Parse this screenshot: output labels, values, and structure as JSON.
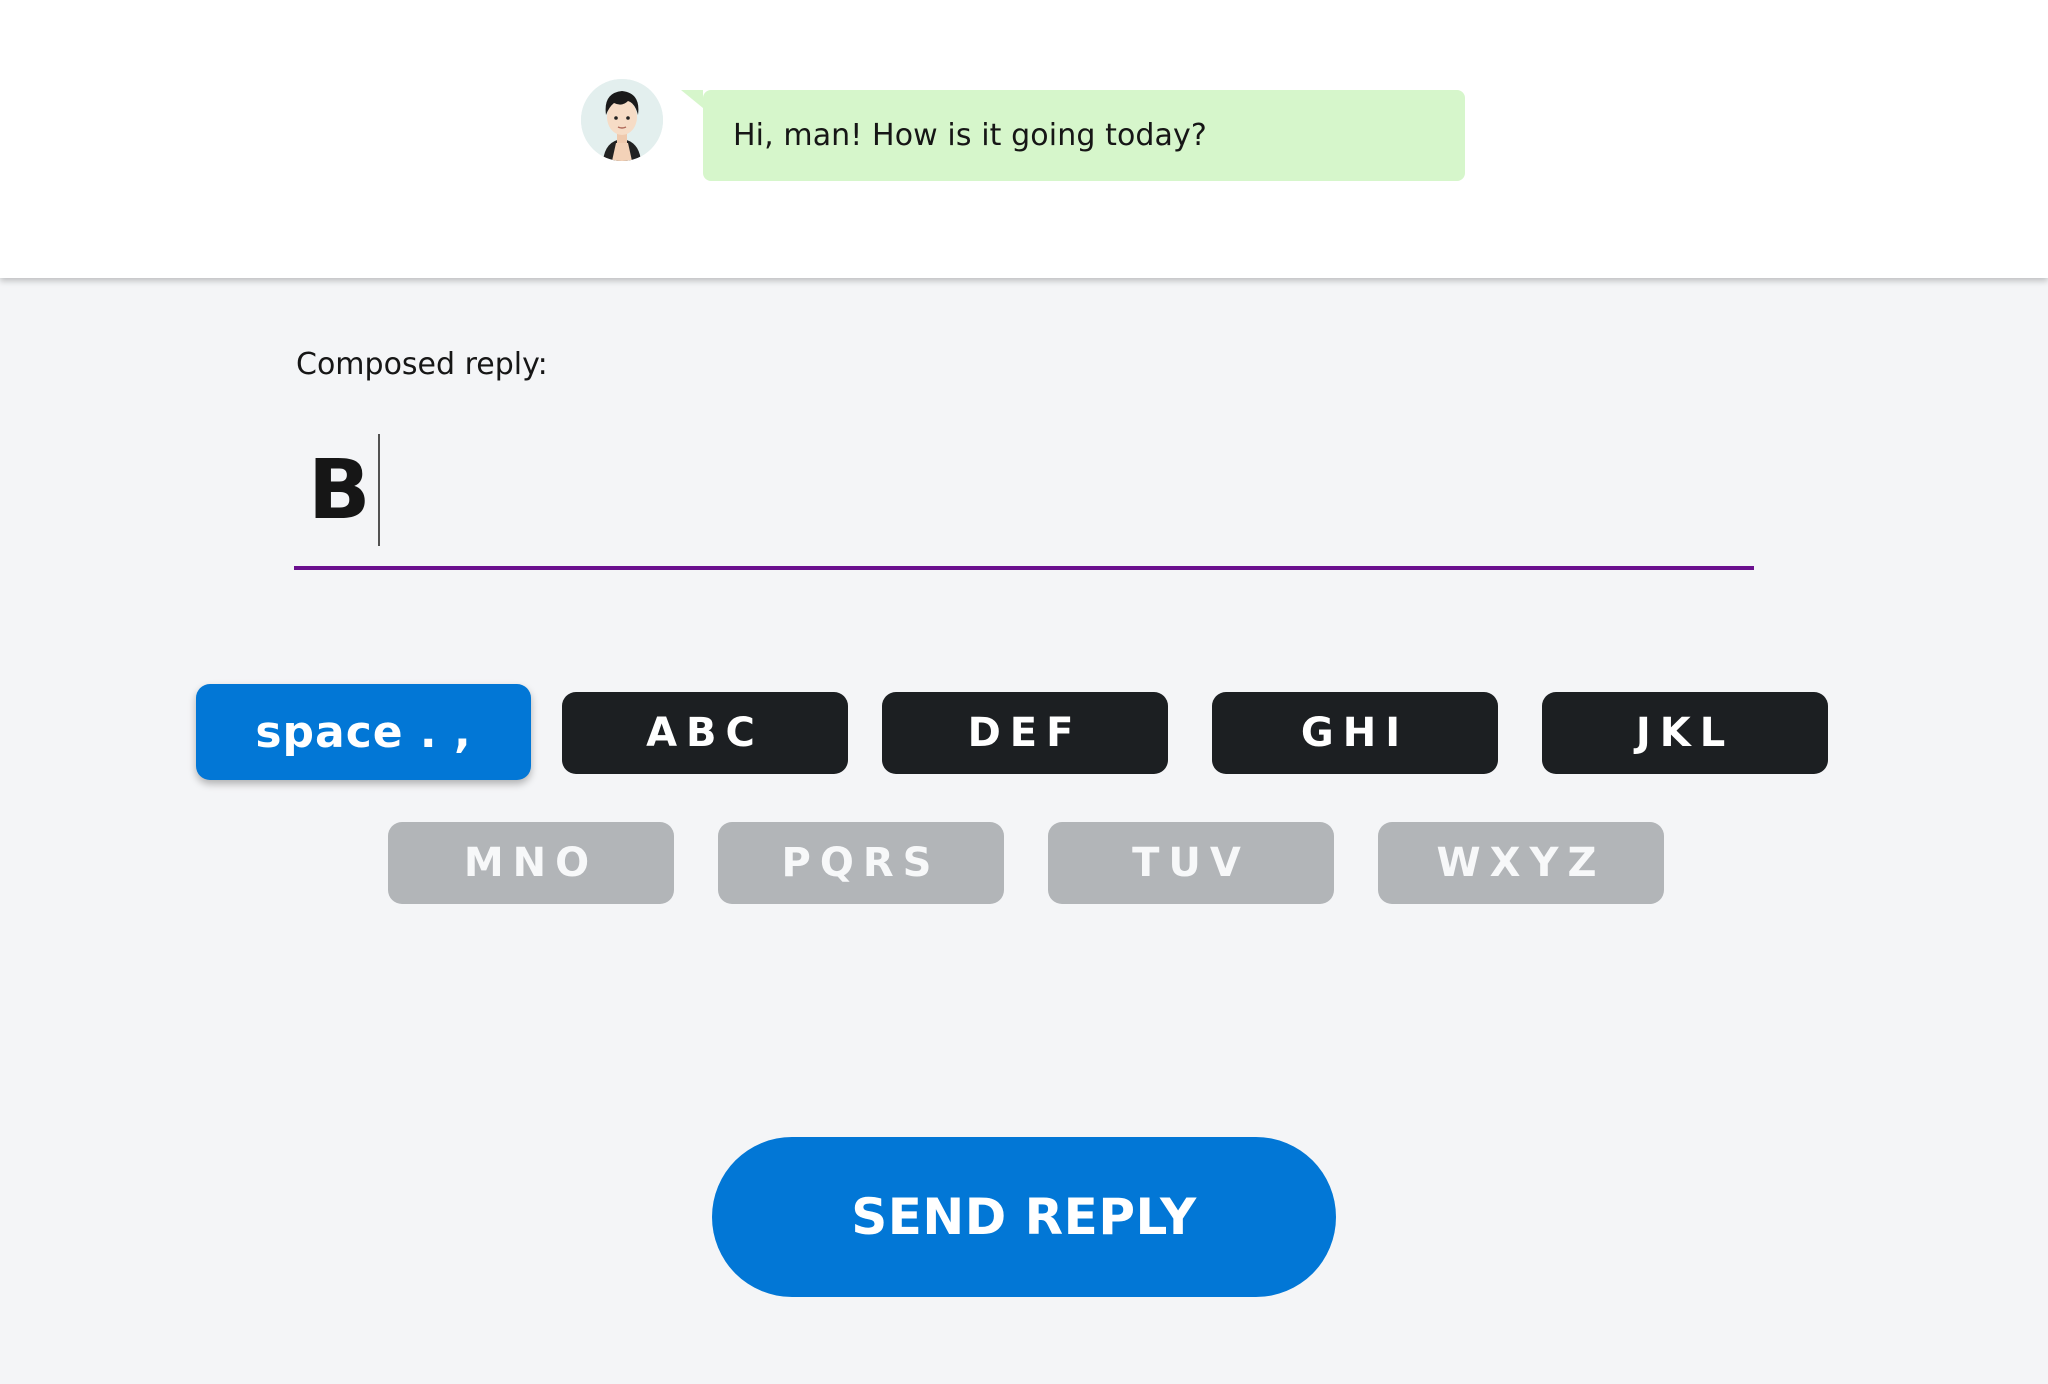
{
  "chat": {
    "incoming_message": "Hi, man! How is it going today?",
    "avatar_icon": "person-avatar-icon",
    "bubble_color": "#d6f6cb"
  },
  "composer": {
    "label": "Composed reply:",
    "value": "B",
    "underline_color": "#6a0f8e"
  },
  "keypad": {
    "keys": [
      {
        "label": "space . ,",
        "state": "selected"
      },
      {
        "label": "ABC",
        "state": "available"
      },
      {
        "label": "DEF",
        "state": "available"
      },
      {
        "label": "GHI",
        "state": "available"
      },
      {
        "label": "JKL",
        "state": "available"
      },
      {
        "label": "MNO",
        "state": "disabled"
      },
      {
        "label": "PQRS",
        "state": "disabled"
      },
      {
        "label": "TUV",
        "state": "disabled"
      },
      {
        "label": "WXYZ",
        "state": "disabled"
      }
    ],
    "colors": {
      "selected": "#0277d6",
      "available": "#1c1f22",
      "disabled": "#b2b5b8"
    }
  },
  "actions": {
    "send_label": "SEND REPLY",
    "send_color": "#0277d6"
  }
}
